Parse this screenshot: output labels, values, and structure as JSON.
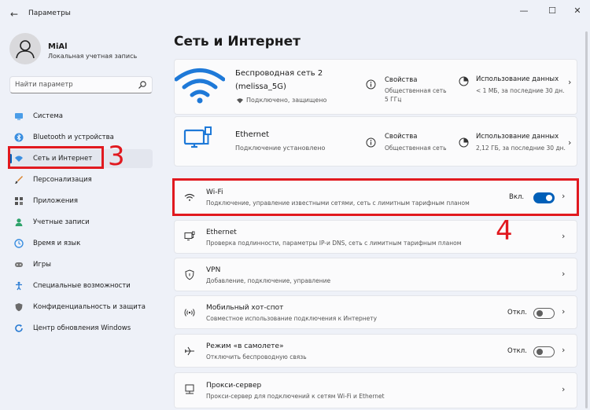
{
  "app": {
    "title": "Параметры"
  },
  "window_controls": {
    "minimize": "—",
    "maximize": "☐",
    "close": "✕",
    "back": "←"
  },
  "user": {
    "name": "MiAl",
    "account_type": "Локальная учетная запись"
  },
  "search": {
    "placeholder": "Найти параметр"
  },
  "sidebar": {
    "items": [
      {
        "label": "Система",
        "icon": "monitor-icon"
      },
      {
        "label": "Bluetooth и устройства",
        "icon": "bluetooth-icon"
      },
      {
        "label": "Сеть и Интернет",
        "icon": "wifi-icon",
        "active": true
      },
      {
        "label": "Персонализация",
        "icon": "brush-icon"
      },
      {
        "label": "Приложения",
        "icon": "apps-icon"
      },
      {
        "label": "Учетные записи",
        "icon": "person-icon"
      },
      {
        "label": "Время и язык",
        "icon": "globe-clock-icon"
      },
      {
        "label": "Игры",
        "icon": "gamepad-icon"
      },
      {
        "label": "Специальные возможности",
        "icon": "accessibility-icon"
      },
      {
        "label": "Конфиденциальность и защита",
        "icon": "shield-icon"
      },
      {
        "label": "Центр обновления Windows",
        "icon": "update-icon"
      }
    ]
  },
  "main": {
    "title": "Сеть и Интернет",
    "wireless": {
      "name_line1": "Беспроводная сеть 2",
      "name_line2": "(melissa_5G)",
      "status": "Подключено, защищено",
      "properties_title": "Свойства",
      "properties_sub1": "Общественная сеть",
      "properties_sub2": "5 ГГц",
      "usage_title": "Использование данных",
      "usage_sub": "< 1 МБ, за последние 30 дн."
    },
    "ethernet_status": {
      "name": "Ethernet",
      "status": "Подключение установлено",
      "properties_title": "Свойства",
      "properties_sub": "Общественная сеть",
      "usage_title": "Использование данных",
      "usage_sub": "2,12 ГБ, за последние 30 дн."
    },
    "rows": [
      {
        "title": "Wi-Fi",
        "subtitle": "Подключение, управление известными сетями, сеть с лимитным тарифным планом",
        "toggle": "Вкл.",
        "icon": "wifi-icon"
      },
      {
        "title": "Ethernet",
        "subtitle": "Проверка подлинности, параметры IP-и DNS, сеть с лимитным тарифным планом",
        "icon": "ethernet-icon"
      },
      {
        "title": "VPN",
        "subtitle": "Добавление, подключение, управление",
        "icon": "shield-icon"
      },
      {
        "title": "Мобильный хот-спот",
        "subtitle": "Совместное использование подключения к Интернету",
        "toggle": "Откл.",
        "icon": "hotspot-icon"
      },
      {
        "title": "Режим «в самолете»",
        "subtitle": "Отключить беспроводную связь",
        "toggle": "Откл.",
        "icon": "airplane-icon"
      },
      {
        "title": "Прокси-сервер",
        "subtitle": "Прокси-сервер для подключений к сетям Wi-Fi и Ethernet",
        "icon": "proxy-icon"
      }
    ]
  },
  "annotations": {
    "step3": "3",
    "step4": "4"
  },
  "colors": {
    "accent": "#005fb8",
    "annotation": "#e1191f",
    "background": "#eef1f8",
    "card": "#fbfbfc"
  }
}
